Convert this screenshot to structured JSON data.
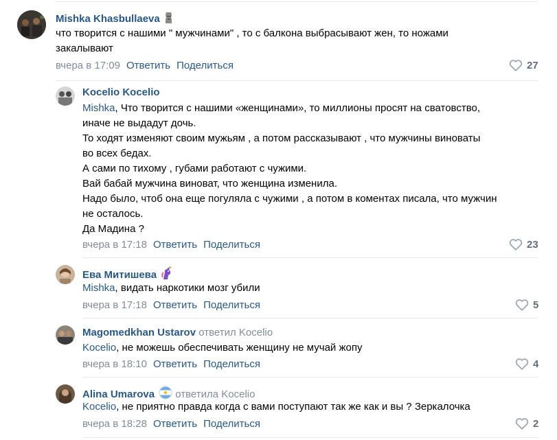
{
  "comments": [
    {
      "author": "Mishka Khasbullaeva",
      "text_lines": [
        "что творится с нашими \" мужчинами\" , то с балкона выбрасывают жен, то ножами",
        "закалывают"
      ],
      "time": "вчера в 17:09",
      "reply_label": "Ответить",
      "share_label": "Поделиться",
      "likes": "27"
    },
    {
      "author": "Kocelio Kocelio",
      "mention": "Mishka",
      "text_lines": [
        ", Что творится с нашими «женщинами», то миллионы просят на сватовство,",
        "иначе не выдадут дочь.",
        "То ходят изменяют своим мужьям , а потом рассказывают , что мужчины виноваты",
        "во всех бедах.",
        "А сами по тихому , губами работают с чужими.",
        "Вай бабай мужчина виноват, что женщина изменила.",
        "Надо было, чтоб она еще погуляла с чужими , а потом в коментах писала, что мужчин",
        "не осталось.",
        "Да Мадина ?"
      ],
      "time": "вчера в 17:18",
      "reply_label": "Ответить",
      "share_label": "Поделиться",
      "likes": "23"
    },
    {
      "author": "Ева Митишева",
      "mention": "Mishka",
      "text": ", видать наркотики мозг убили",
      "time": "вчера в 17:18",
      "reply_label": "Ответить",
      "share_label": "Поделиться",
      "likes": "5"
    },
    {
      "author": "Magomedkhan Ustarov",
      "replied_to": "ответил Kocelio",
      "mention": "Kocelio",
      "text": ", не можешь обеспечивать женщину не мучай жопу",
      "time": "вчера в 18:10",
      "reply_label": "Ответить",
      "share_label": "Поделиться",
      "likes": "4"
    },
    {
      "author": "Alina Umarova",
      "replied_to": "ответила Kocelio",
      "mention": "Kocelio",
      "text": ", не приятно правда когда с вами поступают так же как и вы ? Зеркалочка",
      "time": "вчера в 18:28",
      "reply_label": "Ответить",
      "share_label": "Поделиться",
      "likes": "2"
    }
  ],
  "colors": {
    "link": "#2a5885",
    "meta": "#818c99",
    "separator": "#e7e8ec",
    "like_icon": "#99a2ad"
  },
  "icons": {
    "like": "heart-outline-icon",
    "badge_moai": "moai-icon",
    "badge_unicorn": "unicorn-icon",
    "badge_flag": "flag-argentina-icon"
  }
}
